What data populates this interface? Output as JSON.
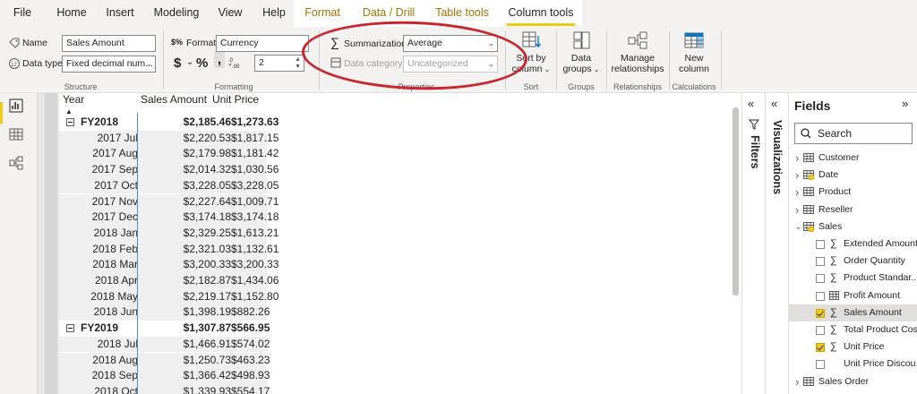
{
  "menu": {
    "tabs": [
      "File",
      "Home",
      "Insert",
      "Modeling",
      "View",
      "Help",
      "Format",
      "Data / Drill",
      "Table tools",
      "Column tools"
    ],
    "active_tab": "Column tools"
  },
  "ribbon": {
    "structure": {
      "name_label": "Name",
      "name_value": "Sales Amount",
      "datatype_label": "Data type",
      "datatype_value": "Fixed decimal num...",
      "group_title": "Structure"
    },
    "formatting": {
      "format_label": "Format",
      "format_value": "Currency",
      "currency_symbol": "$",
      "percent_symbol": "%",
      "comma_symbol": ",",
      "decimals_value": "2",
      "group_title": "Formatting"
    },
    "properties": {
      "summarization_label": "Summarization",
      "summarization_value": "Average",
      "datacategory_label": "Data category",
      "datacategory_value": "Uncategorized",
      "group_title": "Properties"
    },
    "sort": {
      "button_line1": "Sort by",
      "button_line2": "column",
      "group_title": "Sort"
    },
    "groups": {
      "button_line1": "Data",
      "button_line2": "groups",
      "group_title": "Groups"
    },
    "relationships": {
      "button_line1": "Manage",
      "button_line2": "relationships",
      "group_title": "Relationships"
    },
    "calculations": {
      "button_line1": "New",
      "button_line2": "column",
      "group_title": "Calculations"
    }
  },
  "matrix": {
    "headers": {
      "year": "Year",
      "sales": "Sales Amount",
      "unit": "Unit Price"
    },
    "rows": [
      {
        "kind": "parent",
        "year": "FY2018",
        "sales": "$2,185.46",
        "unit": "$1,273.63"
      },
      {
        "kind": "child",
        "year": "2017 Jul",
        "sales": "$2,220.53",
        "unit": "$1,817.15"
      },
      {
        "kind": "child",
        "year": "2017 Aug",
        "sales": "$2,179.98",
        "unit": "$1,181.42"
      },
      {
        "kind": "child",
        "year": "2017 Sep",
        "sales": "$2,014.32",
        "unit": "$1,030.56"
      },
      {
        "kind": "child",
        "year": "2017 Oct",
        "sales": "$3,228.05",
        "unit": "$3,228.05"
      },
      {
        "kind": "child",
        "year": "2017 Nov",
        "sales": "$2,227.64",
        "unit": "$1,009.71"
      },
      {
        "kind": "child",
        "year": "2017 Dec",
        "sales": "$3,174.18",
        "unit": "$3,174.18"
      },
      {
        "kind": "child",
        "year": "2018 Jan",
        "sales": "$2,329.25",
        "unit": "$1,613.21"
      },
      {
        "kind": "child",
        "year": "2018 Feb",
        "sales": "$2,321.03",
        "unit": "$1,132.61"
      },
      {
        "kind": "child",
        "year": "2018 Mar",
        "sales": "$3,200.33",
        "unit": "$3,200.33"
      },
      {
        "kind": "child",
        "year": "2018 Apr",
        "sales": "$2,182.87",
        "unit": "$1,434.06"
      },
      {
        "kind": "child",
        "year": "2018 May",
        "sales": "$2,219.17",
        "unit": "$1,152.80"
      },
      {
        "kind": "child",
        "year": "2018 Jun",
        "sales": "$1,398.19",
        "unit": "$882.26"
      },
      {
        "kind": "parent",
        "year": "FY2019",
        "sales": "$1,307.87",
        "unit": "$566.95"
      },
      {
        "kind": "child",
        "year": "2018 Jul",
        "sales": "$1,466.91",
        "unit": "$574.02"
      },
      {
        "kind": "child",
        "year": "2018 Aug",
        "sales": "$1,250.73",
        "unit": "$463.23"
      },
      {
        "kind": "child",
        "year": "2018 Sep",
        "sales": "$1,366.42",
        "unit": "$498.93"
      },
      {
        "kind": "child",
        "year": "2018 Oct",
        "sales": "$1,339.93",
        "unit": "$554.17"
      }
    ]
  },
  "panes": {
    "filters_label": "Filters",
    "visualizations_label": "Visualizations",
    "fields_title": "Fields",
    "search_placeholder": "Search"
  },
  "fields": [
    {
      "kind": "table",
      "label": "Customer",
      "expanded": false,
      "icon": "table-icon"
    },
    {
      "kind": "table",
      "label": "Date",
      "expanded": false,
      "icon": "table-checked-icon"
    },
    {
      "kind": "table",
      "label": "Product",
      "expanded": false,
      "icon": "table-icon"
    },
    {
      "kind": "table",
      "label": "Reseller",
      "expanded": false,
      "icon": "table-icon"
    },
    {
      "kind": "table",
      "label": "Sales",
      "expanded": true,
      "icon": "table-checked-icon"
    },
    {
      "kind": "field",
      "label": "Extended Amount",
      "checked": false,
      "icon": "sigma"
    },
    {
      "kind": "field",
      "label": "Order Quantity",
      "checked": false,
      "icon": "sigma"
    },
    {
      "kind": "field",
      "label": "Product Standar...",
      "checked": false,
      "icon": "sigma"
    },
    {
      "kind": "field",
      "label": "Profit Amount",
      "checked": false,
      "icon": "calc-table-icon"
    },
    {
      "kind": "field",
      "label": "Sales Amount",
      "checked": true,
      "icon": "sigma",
      "selected": true
    },
    {
      "kind": "field",
      "label": "Total Product Cost",
      "checked": false,
      "icon": "sigma"
    },
    {
      "kind": "field",
      "label": "Unit Price",
      "checked": true,
      "icon": "sigma"
    },
    {
      "kind": "field",
      "label": "Unit Price Discou...",
      "checked": false,
      "icon": "none"
    },
    {
      "kind": "table",
      "label": "Sales Order",
      "expanded": false,
      "icon": "table-icon"
    }
  ]
}
